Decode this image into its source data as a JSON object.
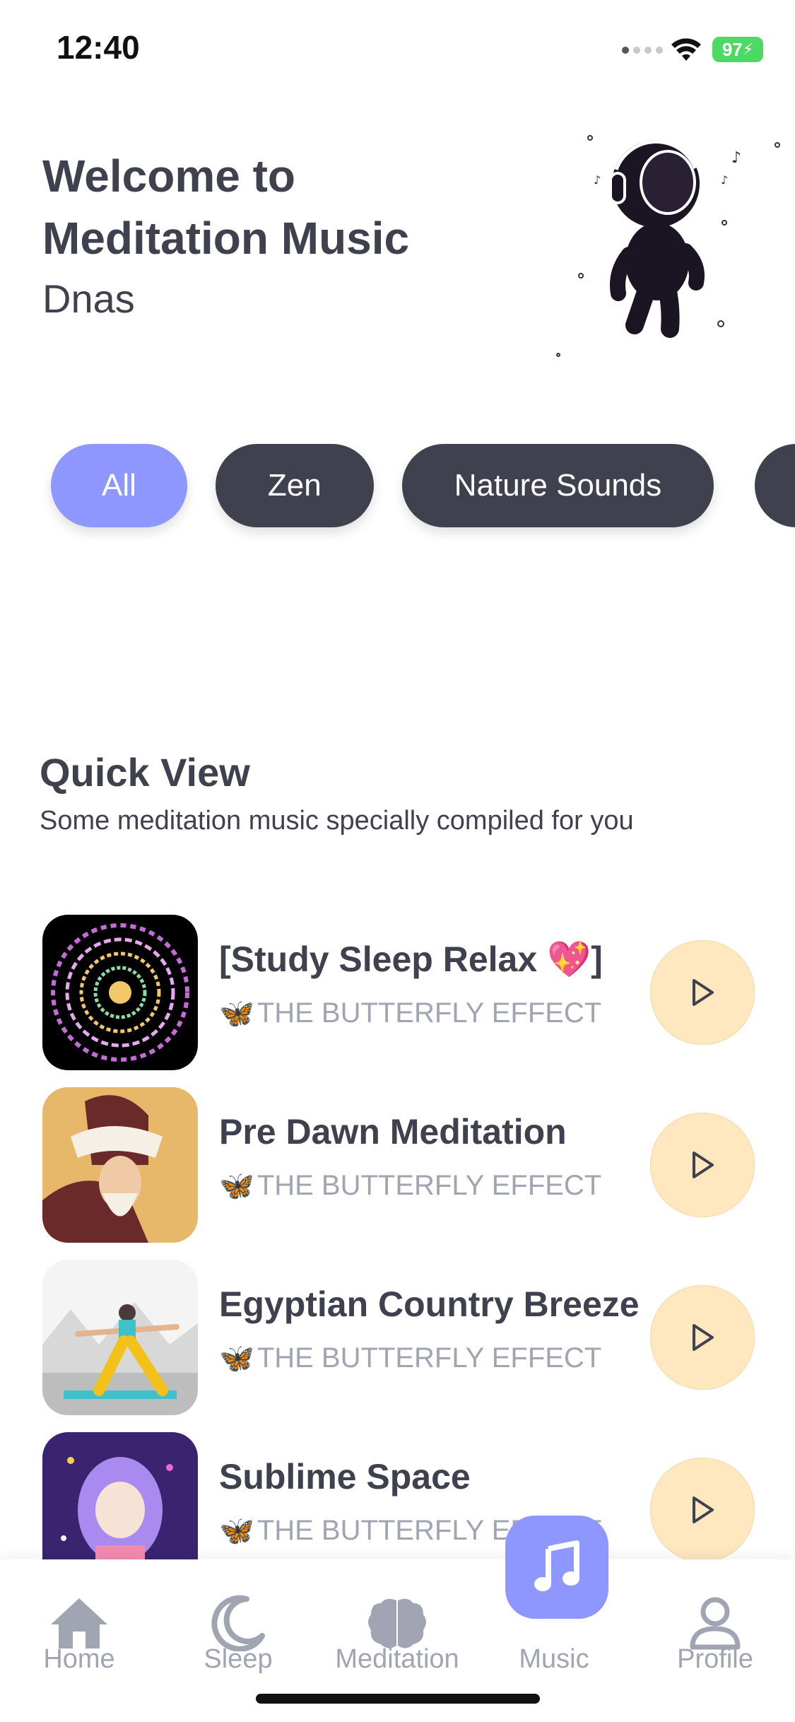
{
  "status_bar": {
    "time": "12:40",
    "battery": "97"
  },
  "header": {
    "welcome_line1": "Welcome to",
    "welcome_line2": "Meditation Music",
    "username": "Dnas"
  },
  "categories": [
    {
      "label": "All",
      "active": true
    },
    {
      "label": "Zen",
      "active": false
    },
    {
      "label": "Nature Sounds",
      "active": false
    }
  ],
  "quick_view": {
    "title": "Quick View",
    "subtitle": "Some meditation music specially compiled for you",
    "tracks": [
      {
        "title": "[Study Sleep Relax 💖]",
        "artist": "THE BUTTERFLY EFFECT",
        "artist_icon": "🦋"
      },
      {
        "title": "Pre Dawn Meditation",
        "artist": "THE BUTTERFLY EFFECT",
        "artist_icon": "🦋"
      },
      {
        "title": "Egyptian Country Breeze",
        "artist": "THE BUTTERFLY EFFECT",
        "artist_icon": "🦋"
      },
      {
        "title": "Sublime Space",
        "artist": "THE BUTTERFLY EFFECT",
        "artist_icon": "🦋"
      }
    ]
  },
  "nav": [
    {
      "label": "Home",
      "icon": "home-icon",
      "active": false
    },
    {
      "label": "Sleep",
      "icon": "moon-icon",
      "active": false
    },
    {
      "label": "Meditation",
      "icon": "brain-icon",
      "active": false
    },
    {
      "label": "Music",
      "icon": "music-note-icon",
      "active": true
    },
    {
      "label": "Profile",
      "icon": "user-icon",
      "active": false
    }
  ],
  "colors": {
    "accent": "#8e97fd",
    "chip_dark": "#3f414e",
    "play_bg": "#ffe7bf",
    "muted": "#a1a4b2"
  }
}
